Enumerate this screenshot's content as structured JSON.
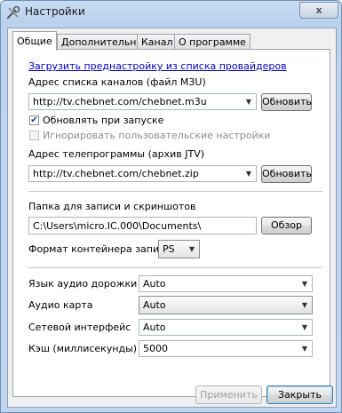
{
  "window": {
    "title": "Настройки",
    "close_symbol": "x"
  },
  "tabs": [
    {
      "label": "Общие",
      "active": true
    },
    {
      "label": "Дополнительно",
      "active": false
    },
    {
      "label": "Канал",
      "active": false
    },
    {
      "label": "О программе",
      "active": false
    }
  ],
  "general": {
    "provider_link": "Загрузить преднастройку из списка провайдеров",
    "channels_label": "Адрес списка каналов (файл M3U)",
    "channels_url": "http://tv.chebnet.com/chebnet.m3u",
    "refresh_label": "Обновить",
    "update_on_start_label": "Обновлять при запуске",
    "update_on_start_checked": true,
    "ignore_user_label": "Игнорировать пользовательские настройки",
    "ignore_user_checked": false,
    "epg_label": "Адрес телепрограммы (архив JTV)",
    "epg_url": "http://tv.chebnet.com/chebnet.zip",
    "record_folder_label": "Папка для записи и скриншотов",
    "record_folder_value": "C:\\Users\\micro.IC.000\\Documents\\",
    "browse_label": "Обзор",
    "container_label": "Формат контейнера записи",
    "container_value": "PS",
    "audio_track_label": "Язык аудио дорожки",
    "audio_track_value": "Auto",
    "audio_card_label": "Аудио карта",
    "audio_card_value": "Auto",
    "network_label": "Сетевой интерфейс",
    "network_value": "Auto",
    "cache_label": "Кэш (миллисекунды)",
    "cache_value": "5000"
  },
  "footer": {
    "apply_label": "Применить",
    "close_label": "Закрыть"
  }
}
